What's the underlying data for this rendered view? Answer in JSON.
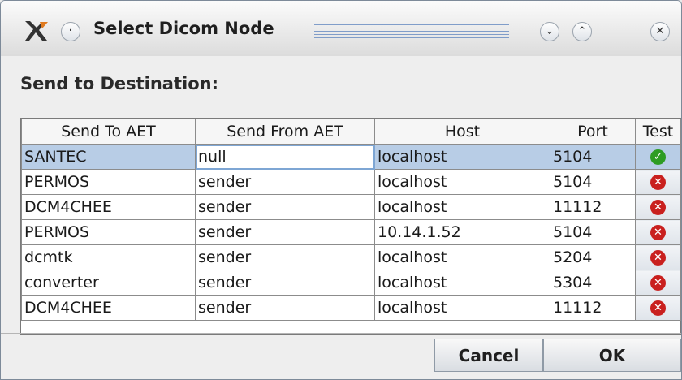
{
  "window": {
    "title": "Select Dicom Node",
    "menu_glyph": "·",
    "minimize_glyph": "⌄",
    "maximize_glyph": "⌃",
    "close_glyph": "✕"
  },
  "heading": "Send to Destination:",
  "table": {
    "columns": [
      "Send To AET",
      "Send From AET",
      "Host",
      "Port",
      "Test"
    ],
    "rows": [
      {
        "send_to_aet": "SANTEC",
        "send_from_aet": "null",
        "host": "localhost",
        "port": "5104",
        "test": "ok",
        "selected": true
      },
      {
        "send_to_aet": "PERMOS",
        "send_from_aet": "sender",
        "host": "localhost",
        "port": "5104",
        "test": "fail"
      },
      {
        "send_to_aet": "DCM4CHEE",
        "send_from_aet": "sender",
        "host": "localhost",
        "port": "11112",
        "test": "fail"
      },
      {
        "send_to_aet": "PERMOS",
        "send_from_aet": "sender",
        "host": "10.14.1.52",
        "port": "5104",
        "test": "fail"
      },
      {
        "send_to_aet": "dcmtk",
        "send_from_aet": "sender",
        "host": "localhost",
        "port": "5204",
        "test": "fail"
      },
      {
        "send_to_aet": "converter",
        "send_from_aet": "sender",
        "host": "localhost",
        "port": "5304",
        "test": "fail"
      },
      {
        "send_to_aet": "DCM4CHEE",
        "send_from_aet": "sender",
        "host": "localhost",
        "port": "11112",
        "test": "fail"
      }
    ]
  },
  "buttons": {
    "cancel": "Cancel",
    "ok": "OK"
  },
  "colors": {
    "ok": "#2e9c23",
    "fail": "#c9201e",
    "selection": "#b8cde6"
  },
  "icons": {
    "ok": "check-icon",
    "fail": "cross-icon"
  }
}
